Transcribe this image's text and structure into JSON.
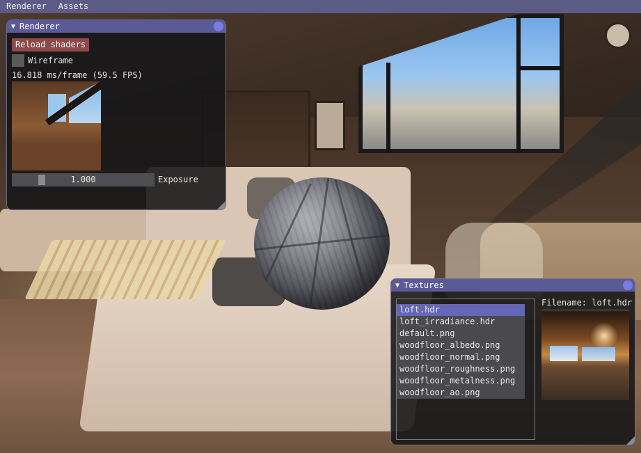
{
  "menubar": {
    "items": [
      "Renderer",
      "Assets"
    ]
  },
  "renderer_window": {
    "title": "Renderer",
    "reload_label": "Reload shaders",
    "wireframe_label": "Wireframe",
    "wireframe_checked": false,
    "fps_text": "16.818 ms/frame (59.5 FPS)",
    "exposure_value": "1.000",
    "exposure_label": "Exposure"
  },
  "textures_window": {
    "title": "Textures",
    "files": [
      "loft.hdr",
      "loft_irradiance.hdr",
      "default.png",
      "woodfloor_albedo.png",
      "woodfloor_normal.png",
      "woodfloor_roughness.png",
      "woodfloor_metalness.png",
      "woodfloor_ao.png"
    ],
    "selected_index": 0,
    "filename_text": "Filename: loft.hdr"
  },
  "colors": {
    "menubar": "#5b5b86",
    "title_bar": "#5a5a98",
    "button": "#8c4a4a",
    "selection": "#6666b8"
  }
}
